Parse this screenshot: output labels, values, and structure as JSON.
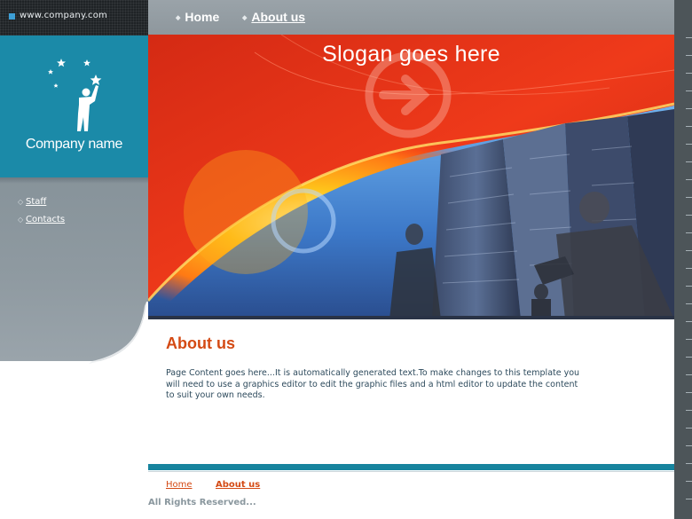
{
  "header": {
    "url": "www.company.com",
    "company_name": "Company name"
  },
  "topnav": {
    "items": [
      {
        "label": "Home",
        "active": false
      },
      {
        "label": "About us",
        "active": true
      }
    ]
  },
  "sidebar": {
    "items": [
      {
        "label": "Staff"
      },
      {
        "label": "Contacts"
      }
    ]
  },
  "hero": {
    "slogan": "Slogan goes here"
  },
  "content": {
    "title": "About us",
    "body": "Page Content goes here...It is automatically generated text.To make changes to this template you will need to use a graphics editor to edit the graphic files and a html editor to update the content to suit your own needs."
  },
  "footer": {
    "links": [
      {
        "label": "Home"
      },
      {
        "label": "About us"
      }
    ],
    "copyright": "All Rights Reserved..."
  },
  "colors": {
    "accent_teal": "#17849e",
    "accent_orange": "#d44a14",
    "nav_gray": "#8f9aa1",
    "hero_red": "#e8341a"
  },
  "icons": [
    "square-bullet-icon",
    "star-person-logo-icon",
    "diamond-bullet-icon",
    "arrow-circle-icon"
  ]
}
